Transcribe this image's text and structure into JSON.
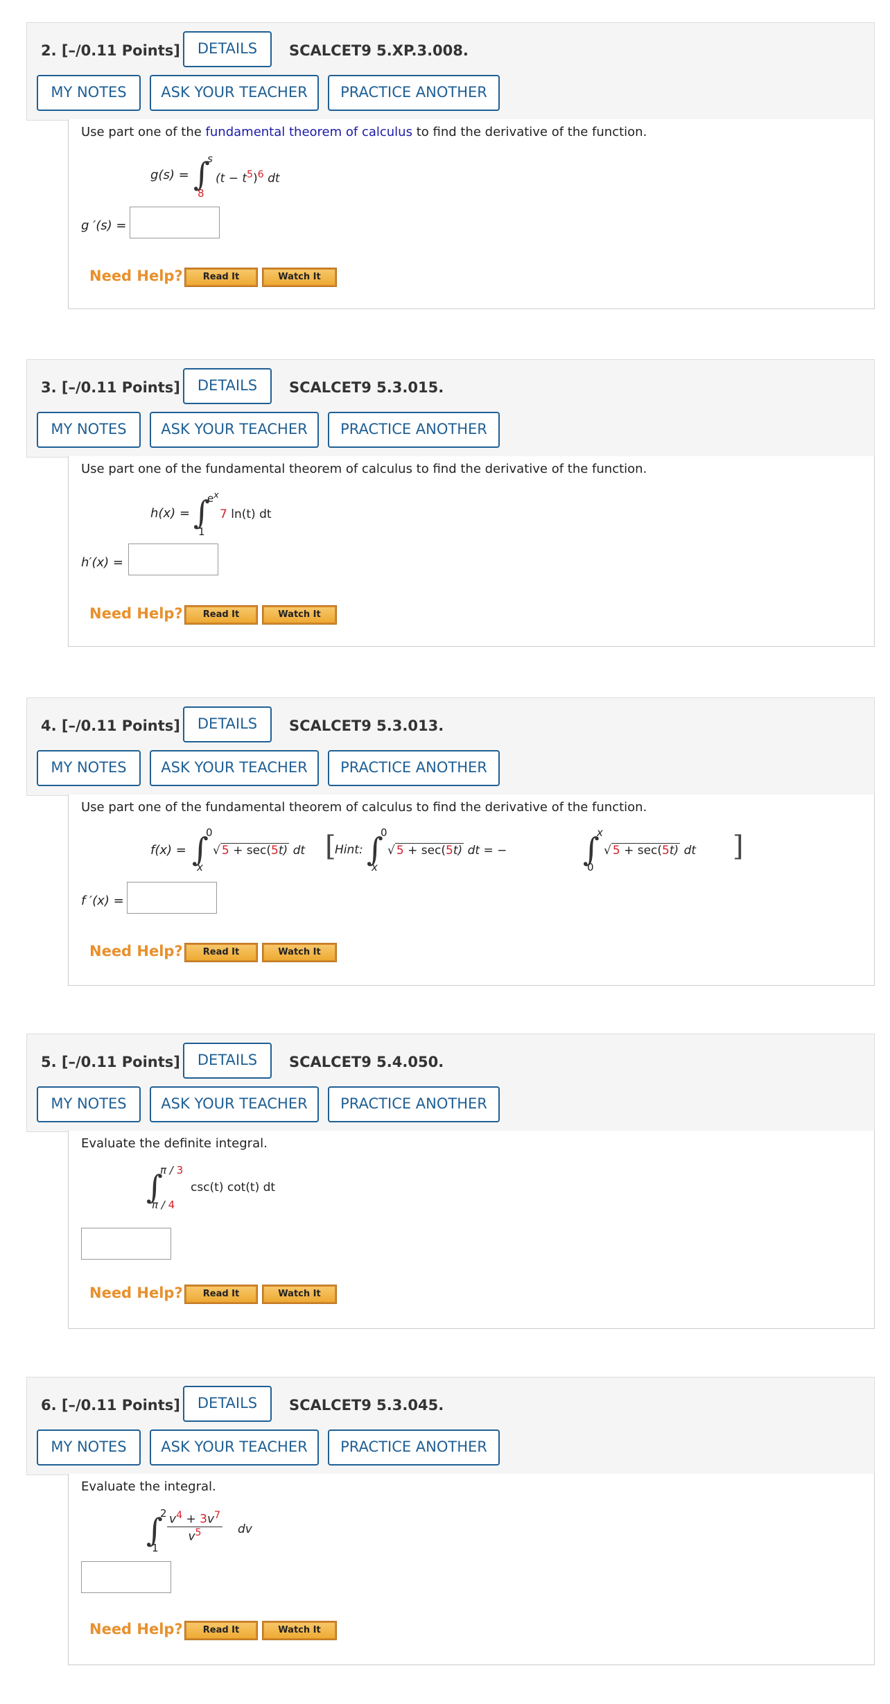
{
  "buttons": {
    "details": "DETAILS",
    "my_notes": "MY NOTES",
    "ask_teacher": "ASK YOUR TEACHER",
    "practice": "PRACTICE ANOTHER",
    "need_help": "Need Help?",
    "read_it": "Read It",
    "watch_it": "Watch It"
  },
  "questions": [
    {
      "title": "2.  [–/0.11 Points]",
      "code": "SCALCET9 5.XP.3.008.",
      "prompt_pre": "Use part one of the ",
      "prompt_link": "fundamental theorem of calculus",
      "prompt_post": " to find the derivative of the function.",
      "fn_lhs": "g(s) =",
      "upper": "s",
      "lower": "8",
      "integrand_a": "(t − t",
      "integrand_exp1": "5",
      "integrand_b": ")",
      "integrand_exp2": "6",
      "integrand_c": " dt",
      "answer_label": "g ′(s) ="
    },
    {
      "title": "3.  [–/0.11 Points]",
      "code": "SCALCET9 5.3.015.",
      "prompt": "Use part one of the fundamental theorem of calculus to find the derivative of the function.",
      "fn_lhs": "h(x) =",
      "upper": "e",
      "upper_exp": "x",
      "lower": "1",
      "coef": "7",
      "integrand": " ln(t) dt",
      "answer_label": "h′(x) ="
    },
    {
      "title": "4.  [–/0.11 Points]",
      "code": "SCALCET9 5.3.013.",
      "prompt": "Use part one of the fundamental theorem of calculus to find the derivative of the function.",
      "fn_lhs": "f(x) =",
      "upper": "0",
      "lower": "x",
      "root_a": "5",
      "root_b": " + sec(",
      "root_c": "5",
      "root_d": "t)",
      "dt": "dt",
      "hint": "Hint:",
      "eq": "dt = −",
      "hint_upper2": "x",
      "hint_lower2": "0",
      "answer_label": "f ′(x) ="
    },
    {
      "title": "5.  [–/0.11 Points]",
      "code": "SCALCET9 5.4.050.",
      "prompt": "Evaluate the definite integral.",
      "upper_a": "π / ",
      "upper_b": "3",
      "lower_a": "π / ",
      "lower_b": "4",
      "integrand": "csc(t) cot(t) dt"
    },
    {
      "title": "6.  [–/0.11 Points]",
      "code": "SCALCET9 5.3.045.",
      "prompt": "Evaluate the integral.",
      "upper": "2",
      "lower": "1",
      "num_a": "v",
      "num_exp1": "4",
      "num_b": " + ",
      "num_coef": "3",
      "num_c": "v",
      "num_exp2": "7",
      "den_a": "v",
      "den_exp": "5",
      "dv": "dv"
    }
  ]
}
